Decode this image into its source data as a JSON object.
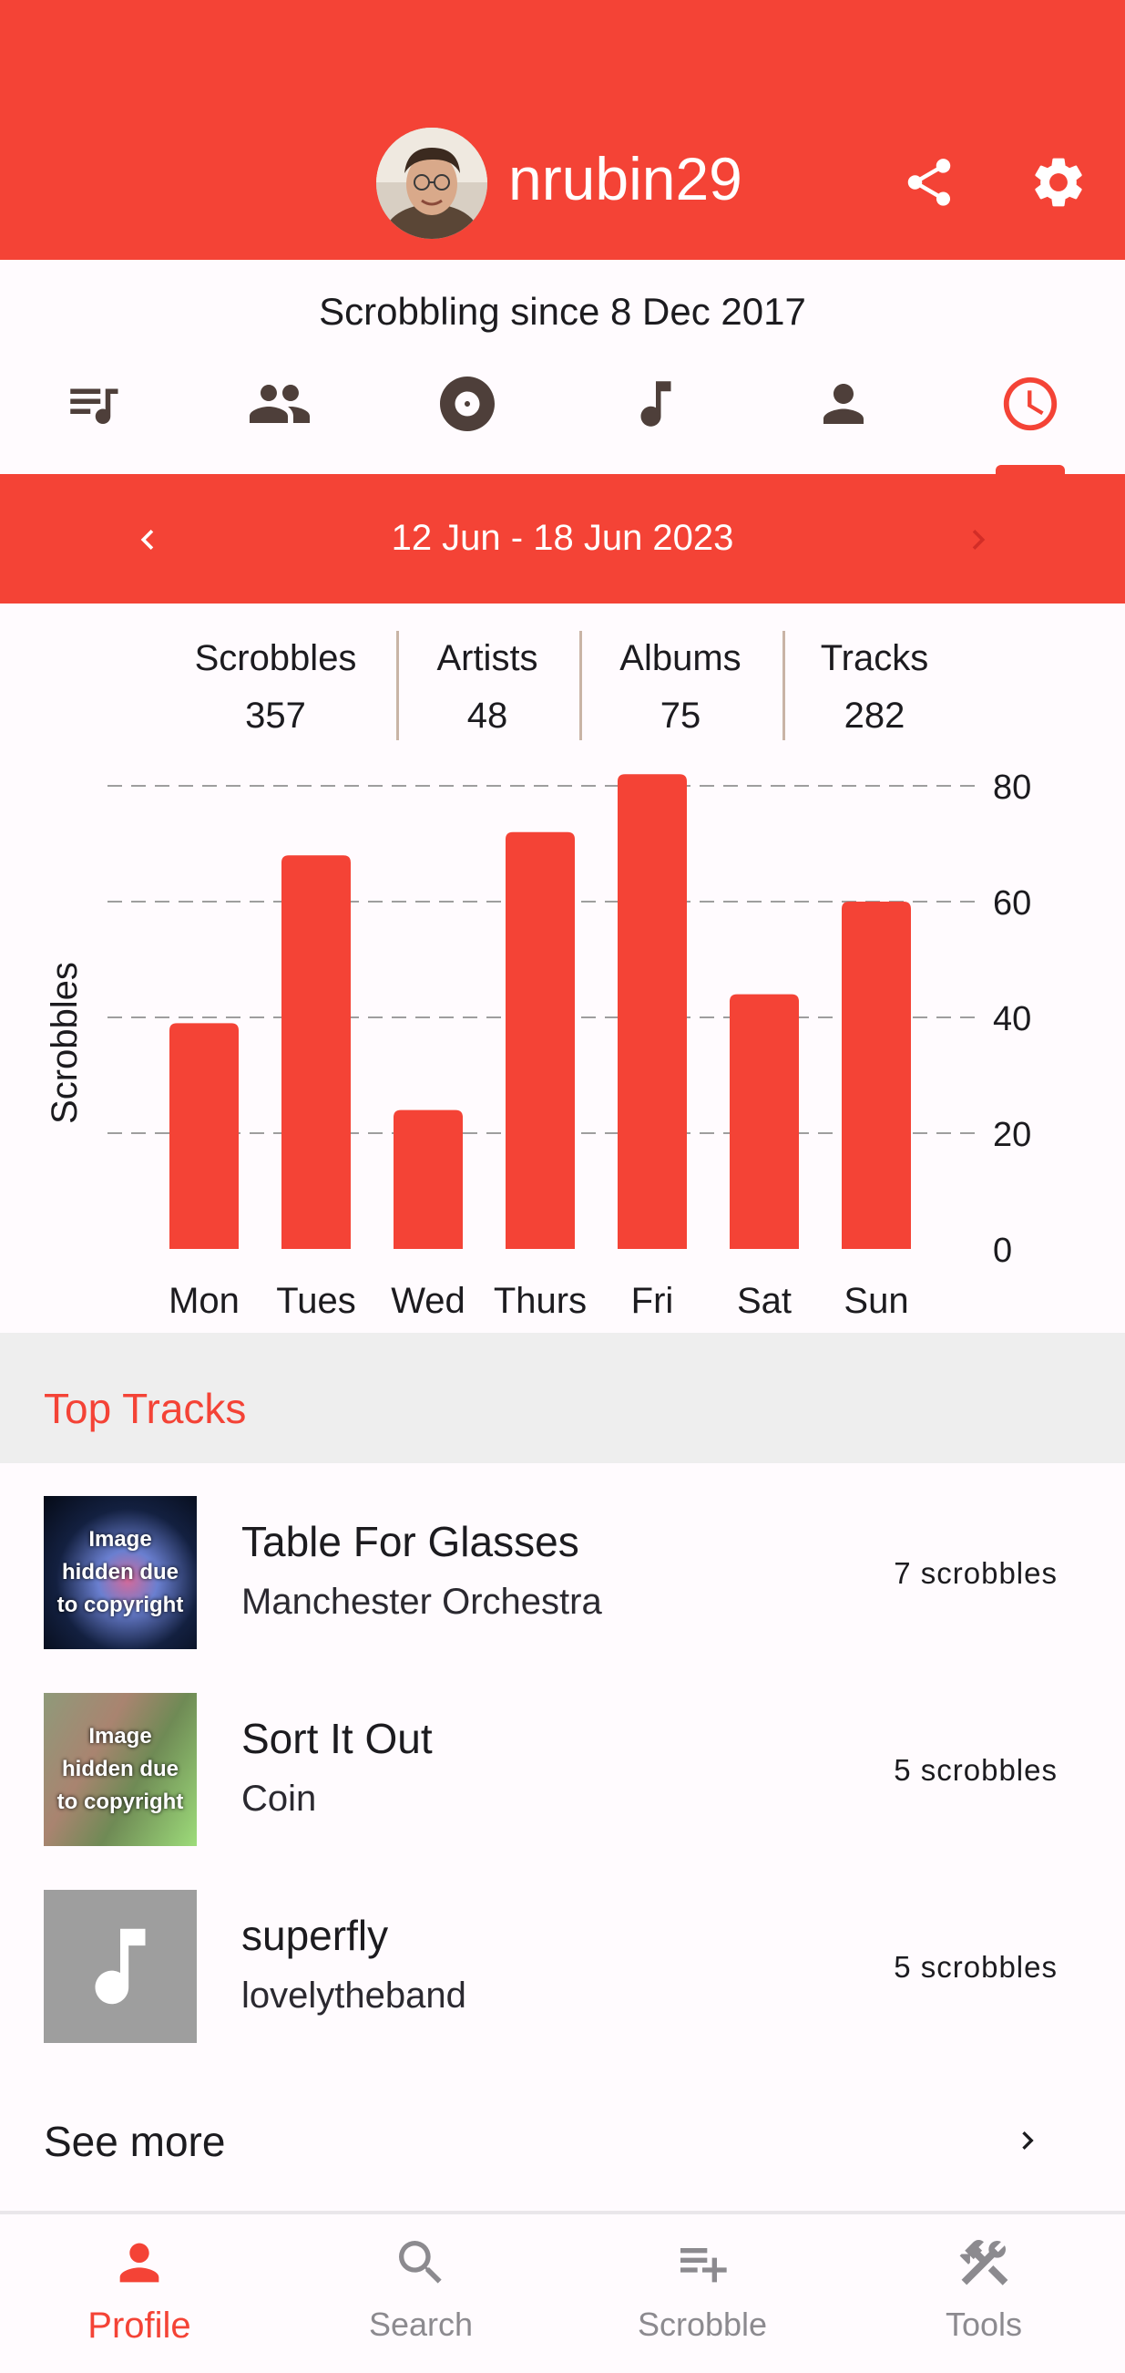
{
  "header": {
    "username": "nrubin29",
    "share_icon": "share-icon",
    "settings_icon": "gear-icon",
    "accent": "#f44336"
  },
  "profile": {
    "since": "Scrobbling since 8 Dec 2017"
  },
  "tabs": [
    {
      "name": "playlist-icon",
      "active": false
    },
    {
      "name": "people-icon",
      "active": false
    },
    {
      "name": "album-icon",
      "active": false
    },
    {
      "name": "music-note-icon",
      "active": false
    },
    {
      "name": "person-icon",
      "active": false
    },
    {
      "name": "clock-icon",
      "active": true
    }
  ],
  "period": {
    "label": "12 Jun - 18 Jun 2023"
  },
  "stats": [
    {
      "label": "Scrobbles",
      "value": "357"
    },
    {
      "label": "Artists",
      "value": "48"
    },
    {
      "label": "Albums",
      "value": "75"
    },
    {
      "label": "Tracks",
      "value": "282"
    }
  ],
  "chart_data": {
    "type": "bar",
    "categories": [
      "Mon",
      "Tues",
      "Wed",
      "Thurs",
      "Fri",
      "Sat",
      "Sun"
    ],
    "values": [
      39,
      68,
      24,
      72,
      82,
      44,
      60
    ],
    "ylabel": "Scrobbles",
    "yticks": [
      "0",
      "20",
      "40",
      "60",
      "80"
    ],
    "ylim": [
      0,
      80
    ],
    "grid": "dashed horizontal",
    "axis_side": "right",
    "color": "#f44336"
  },
  "top_tracks": {
    "title": "Top Tracks",
    "items": [
      {
        "title": "Table For Glasses",
        "artist": "Manchester Orchestra",
        "count": "7 scrobbles",
        "thumb_text": "Image hidden due to copyright"
      },
      {
        "title": "Sort It Out",
        "artist": "Coin",
        "count": "5 scrobbles",
        "thumb_text": "Image hidden due to copyright"
      },
      {
        "title": "superfly",
        "artist": "lovelytheband",
        "count": "5 scrobbles",
        "thumb_text": ""
      }
    ],
    "see_more": "See more"
  },
  "bottom_nav": [
    {
      "label": "Profile",
      "icon": "person-icon",
      "active": true
    },
    {
      "label": "Search",
      "icon": "search-icon",
      "active": false
    },
    {
      "label": "Scrobble",
      "icon": "playlist-add-icon",
      "active": false
    },
    {
      "label": "Tools",
      "icon": "tools-icon",
      "active": false
    }
  ]
}
